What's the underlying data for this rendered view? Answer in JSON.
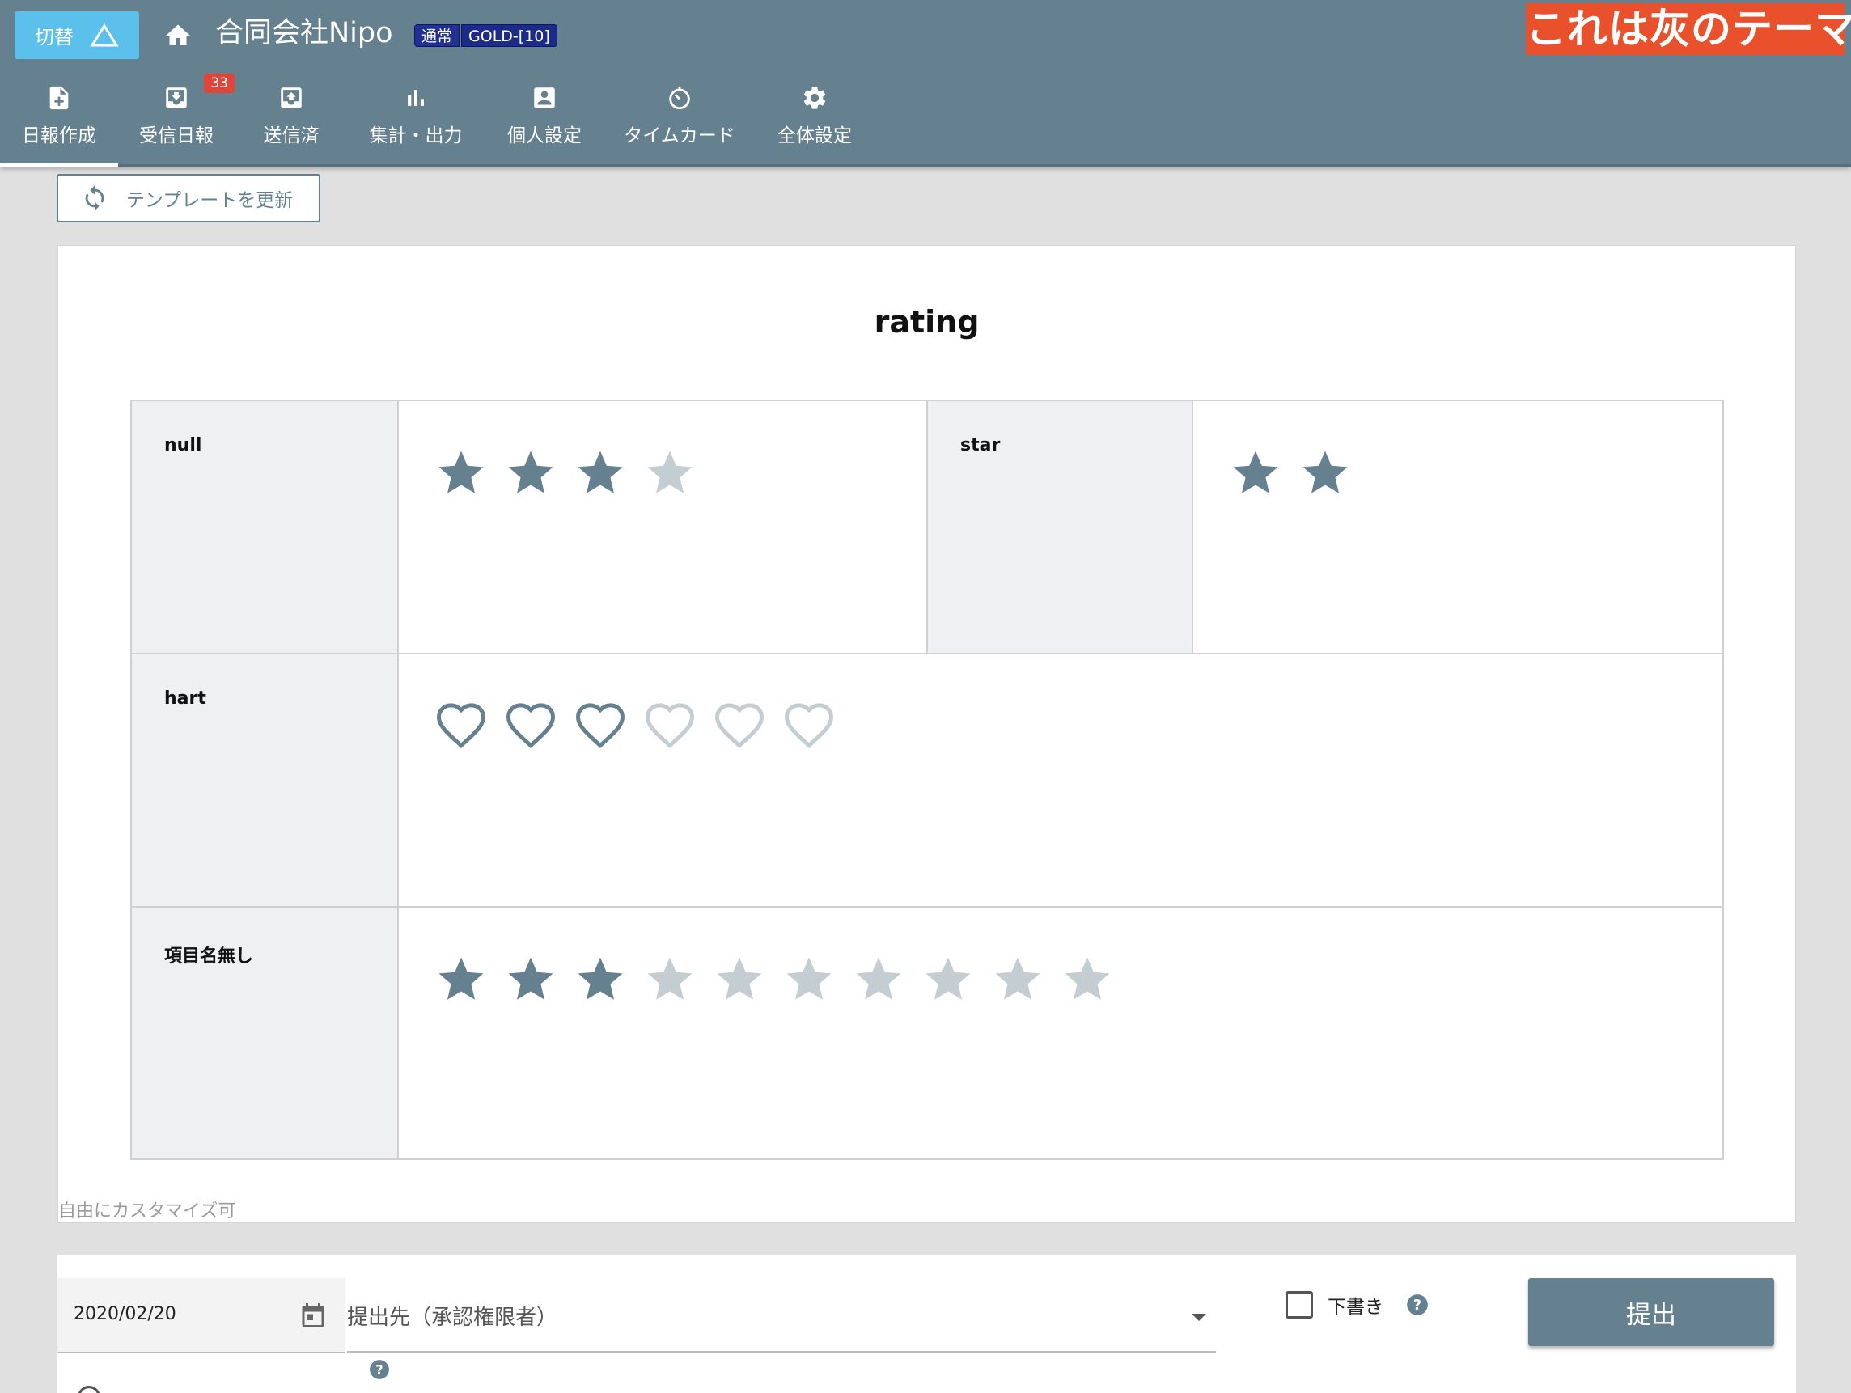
{
  "header": {
    "switch_label": "切替",
    "company_name": "合同会社Nipo",
    "plan_badges": [
      "通常",
      "GOLD-[10]"
    ],
    "theme_label": "これは灰のテーマ",
    "nav": [
      {
        "label": "日報作成",
        "icon": "file-plus-icon",
        "active": true
      },
      {
        "label": "受信日報",
        "icon": "inbox-icon",
        "badge": "33"
      },
      {
        "label": "送信済",
        "icon": "outbox-icon"
      },
      {
        "label": "集計・出力",
        "icon": "bar-chart-icon"
      },
      {
        "label": "個人設定",
        "icon": "account-box-icon"
      },
      {
        "label": "タイムカード",
        "icon": "timer-icon"
      },
      {
        "label": "全体設定",
        "icon": "gear-icon"
      }
    ]
  },
  "toolbar": {
    "template_update_label": "テンプレートを更新"
  },
  "form": {
    "title": "rating",
    "rows": [
      {
        "label": "null",
        "icon": "star",
        "value": 3,
        "max": 4
      },
      {
        "label": "star",
        "icon": "star",
        "value": 2,
        "max": 2
      },
      {
        "label": "hart",
        "icon": "heart",
        "value": 3,
        "max": 6
      },
      {
        "label": "項目名無し",
        "icon": "star",
        "value": 3,
        "max": 10
      }
    ],
    "custom_note": "自由にカスタマイズ可"
  },
  "bottom": {
    "date": "2020/02/20",
    "destination_placeholder": "提出先（承認権限者）",
    "draft_label": "下書き",
    "draft_checked": false,
    "submit_label": "提出"
  },
  "colors": {
    "header": "#65808f",
    "switch": "#5bc0eb",
    "theme_label": "#e8512c",
    "icon_filled": "#65808f",
    "icon_empty": "#c3cdd2",
    "nav_badge": "#e0453a"
  }
}
